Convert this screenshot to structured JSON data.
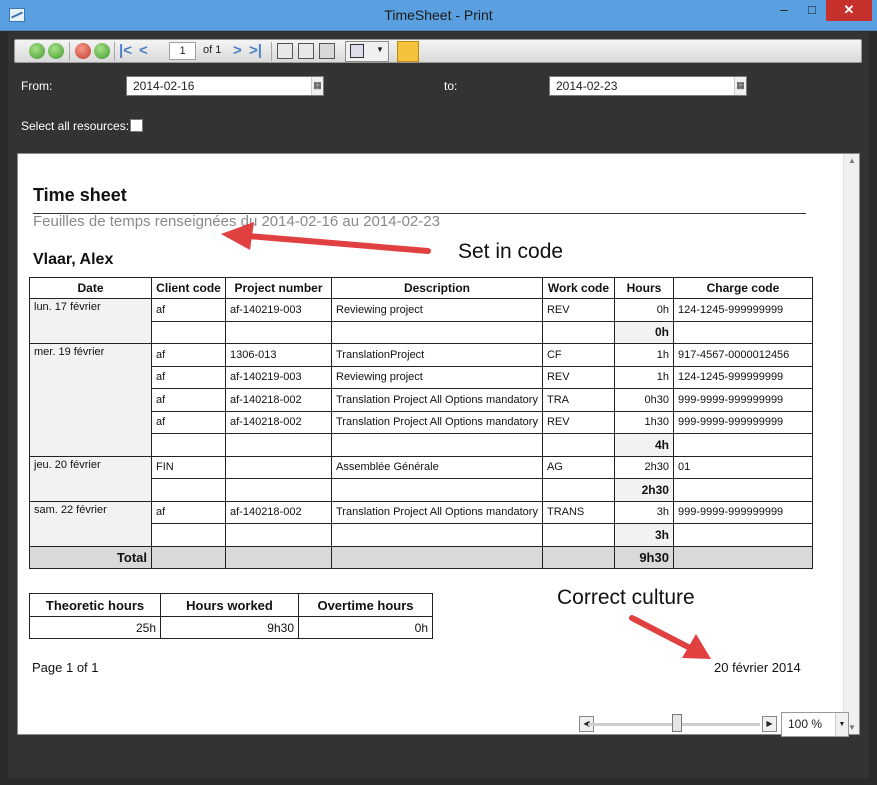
{
  "window": {
    "title": "TimeSheet - Print",
    "minimize": "–",
    "maximize": "□",
    "close": "✕"
  },
  "toolbar": {
    "page_number": "1",
    "page_of": "of 1",
    "icons": [
      "back-green",
      "forward-green",
      "stop-red",
      "refresh-green",
      "first-page",
      "prev-page",
      "next-page",
      "last-page",
      "page-setup",
      "print-preview",
      "print",
      "save",
      "tools"
    ]
  },
  "filters": {
    "from_label": "From:",
    "from_value": "2014-02-16",
    "to_label": "to:",
    "to_value": "2014-02-23",
    "select_all_label": "Select all resources:"
  },
  "report": {
    "title": "Time sheet",
    "subtitle": "Feuilles de temps renseignées du 2014-02-16 au 2014-02-23",
    "person": "Vlaar, Alex",
    "headers": [
      "Date",
      "Client code",
      "Project number",
      "Description",
      "Work code",
      "Hours",
      "Charge code"
    ],
    "days": [
      {
        "date": "lun. 17 février",
        "rows": [
          [
            "af",
            "af-140219-003",
            "Reviewing project",
            "REV",
            "0h",
            "124-1245-999999999"
          ]
        ],
        "subtotal": "0h"
      },
      {
        "date": "mer. 19 février",
        "rows": [
          [
            "af",
            "1306-013",
            "TranslationProject",
            "CF",
            "1h",
            "917-4567-0000012456"
          ],
          [
            "af",
            "af-140219-003",
            "Reviewing project",
            "REV",
            "1h",
            "124-1245-999999999"
          ],
          [
            "af",
            "af-140218-002",
            "Translation Project All Options mandatory",
            "TRA",
            "0h30",
            "999-9999-999999999"
          ],
          [
            "af",
            "af-140218-002",
            "Translation Project All Options mandatory",
            "REV",
            "1h30",
            "999-9999-999999999"
          ]
        ],
        "subtotal": "4h"
      },
      {
        "date": "jeu. 20 février",
        "rows": [
          [
            "FIN",
            "",
            "Assemblée Générale",
            "AG",
            "2h30",
            "01"
          ]
        ],
        "subtotal": "2h30"
      },
      {
        "date": "sam. 22 février",
        "rows": [
          [
            "af",
            "af-140218-002",
            "Translation Project All Options mandatory",
            "TRANS",
            "3h",
            "999-9999-999999999"
          ]
        ],
        "subtotal": "3h"
      }
    ],
    "total_label": "Total",
    "total_value": "9h30",
    "summary_headers": [
      "Theoretic hours",
      "Hours worked",
      "Overtime hours"
    ],
    "summary_values": [
      "25h",
      "9h30",
      "0h"
    ],
    "page_footer": "Page 1 of 1",
    "print_date": "20 février 2014"
  },
  "annotations": {
    "set_in_code": "Set in code",
    "correct_culture": "Correct culture",
    "arrow_color": "#e04040"
  },
  "zoom": {
    "value": "100 %"
  },
  "colors": {
    "titlebar": "#5aa0e0",
    "shell": "#333333",
    "close": "#c7312b"
  }
}
